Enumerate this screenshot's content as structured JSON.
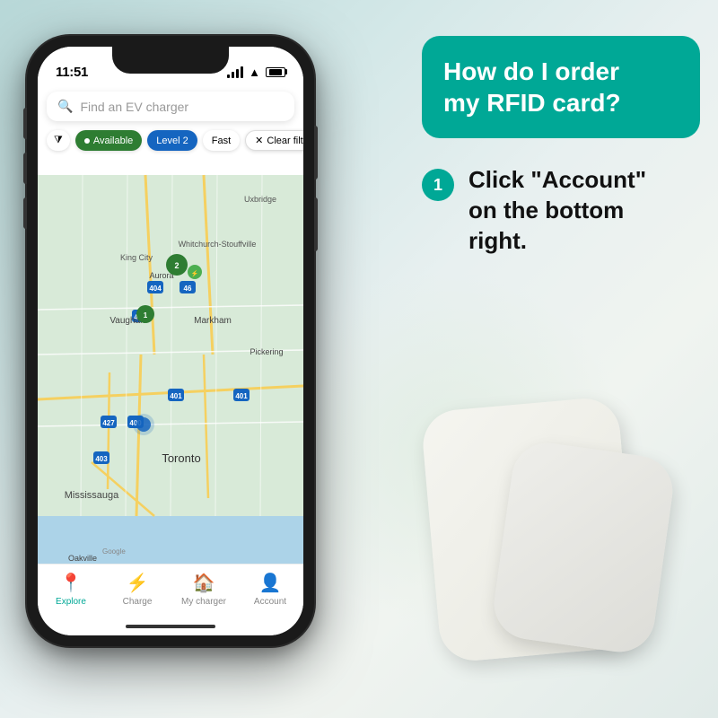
{
  "background": {
    "color": "#c8dfe0"
  },
  "phone": {
    "status_bar": {
      "time": "11:51",
      "time_arrow": "◀",
      "signal": true,
      "wifi": true,
      "battery": true
    },
    "search": {
      "placeholder": "Find an EV charger"
    },
    "filters": [
      {
        "id": "filter-icon",
        "label": "⧩",
        "type": "icon-only"
      },
      {
        "id": "available",
        "label": "Available",
        "active": true,
        "color": "green"
      },
      {
        "id": "level2",
        "label": "Level 2",
        "active": true,
        "color": "blue"
      },
      {
        "id": "fast",
        "label": "Fast",
        "active": false
      },
      {
        "id": "clear",
        "label": "✕  Clear filte",
        "active": false,
        "clear": true
      }
    ],
    "map": {
      "google_label": "Google",
      "cities": [
        "Uxbridge",
        "Whitchurch-Stouffville",
        "King City",
        "Vaughan",
        "Markham",
        "Pickering",
        "Toronto",
        "Mississauga",
        "Oakville",
        "Aurora"
      ],
      "roads": "highway network"
    },
    "nav": [
      {
        "id": "explore",
        "label": "Explore",
        "icon": "📍",
        "active": true
      },
      {
        "id": "charge",
        "label": "Charge",
        "icon": "⚡",
        "active": false
      },
      {
        "id": "my-charger",
        "label": "My charger",
        "icon": "🏠",
        "active": false
      },
      {
        "id": "account",
        "label": "Account",
        "icon": "👤",
        "active": false
      }
    ]
  },
  "right_panel": {
    "question": {
      "line1": "How do I order",
      "line2": "my RFID card?"
    },
    "steps": [
      {
        "number": "1",
        "text_parts": [
          "Click ",
          "\"Account\"",
          " on the bottom right."
        ]
      }
    ]
  }
}
